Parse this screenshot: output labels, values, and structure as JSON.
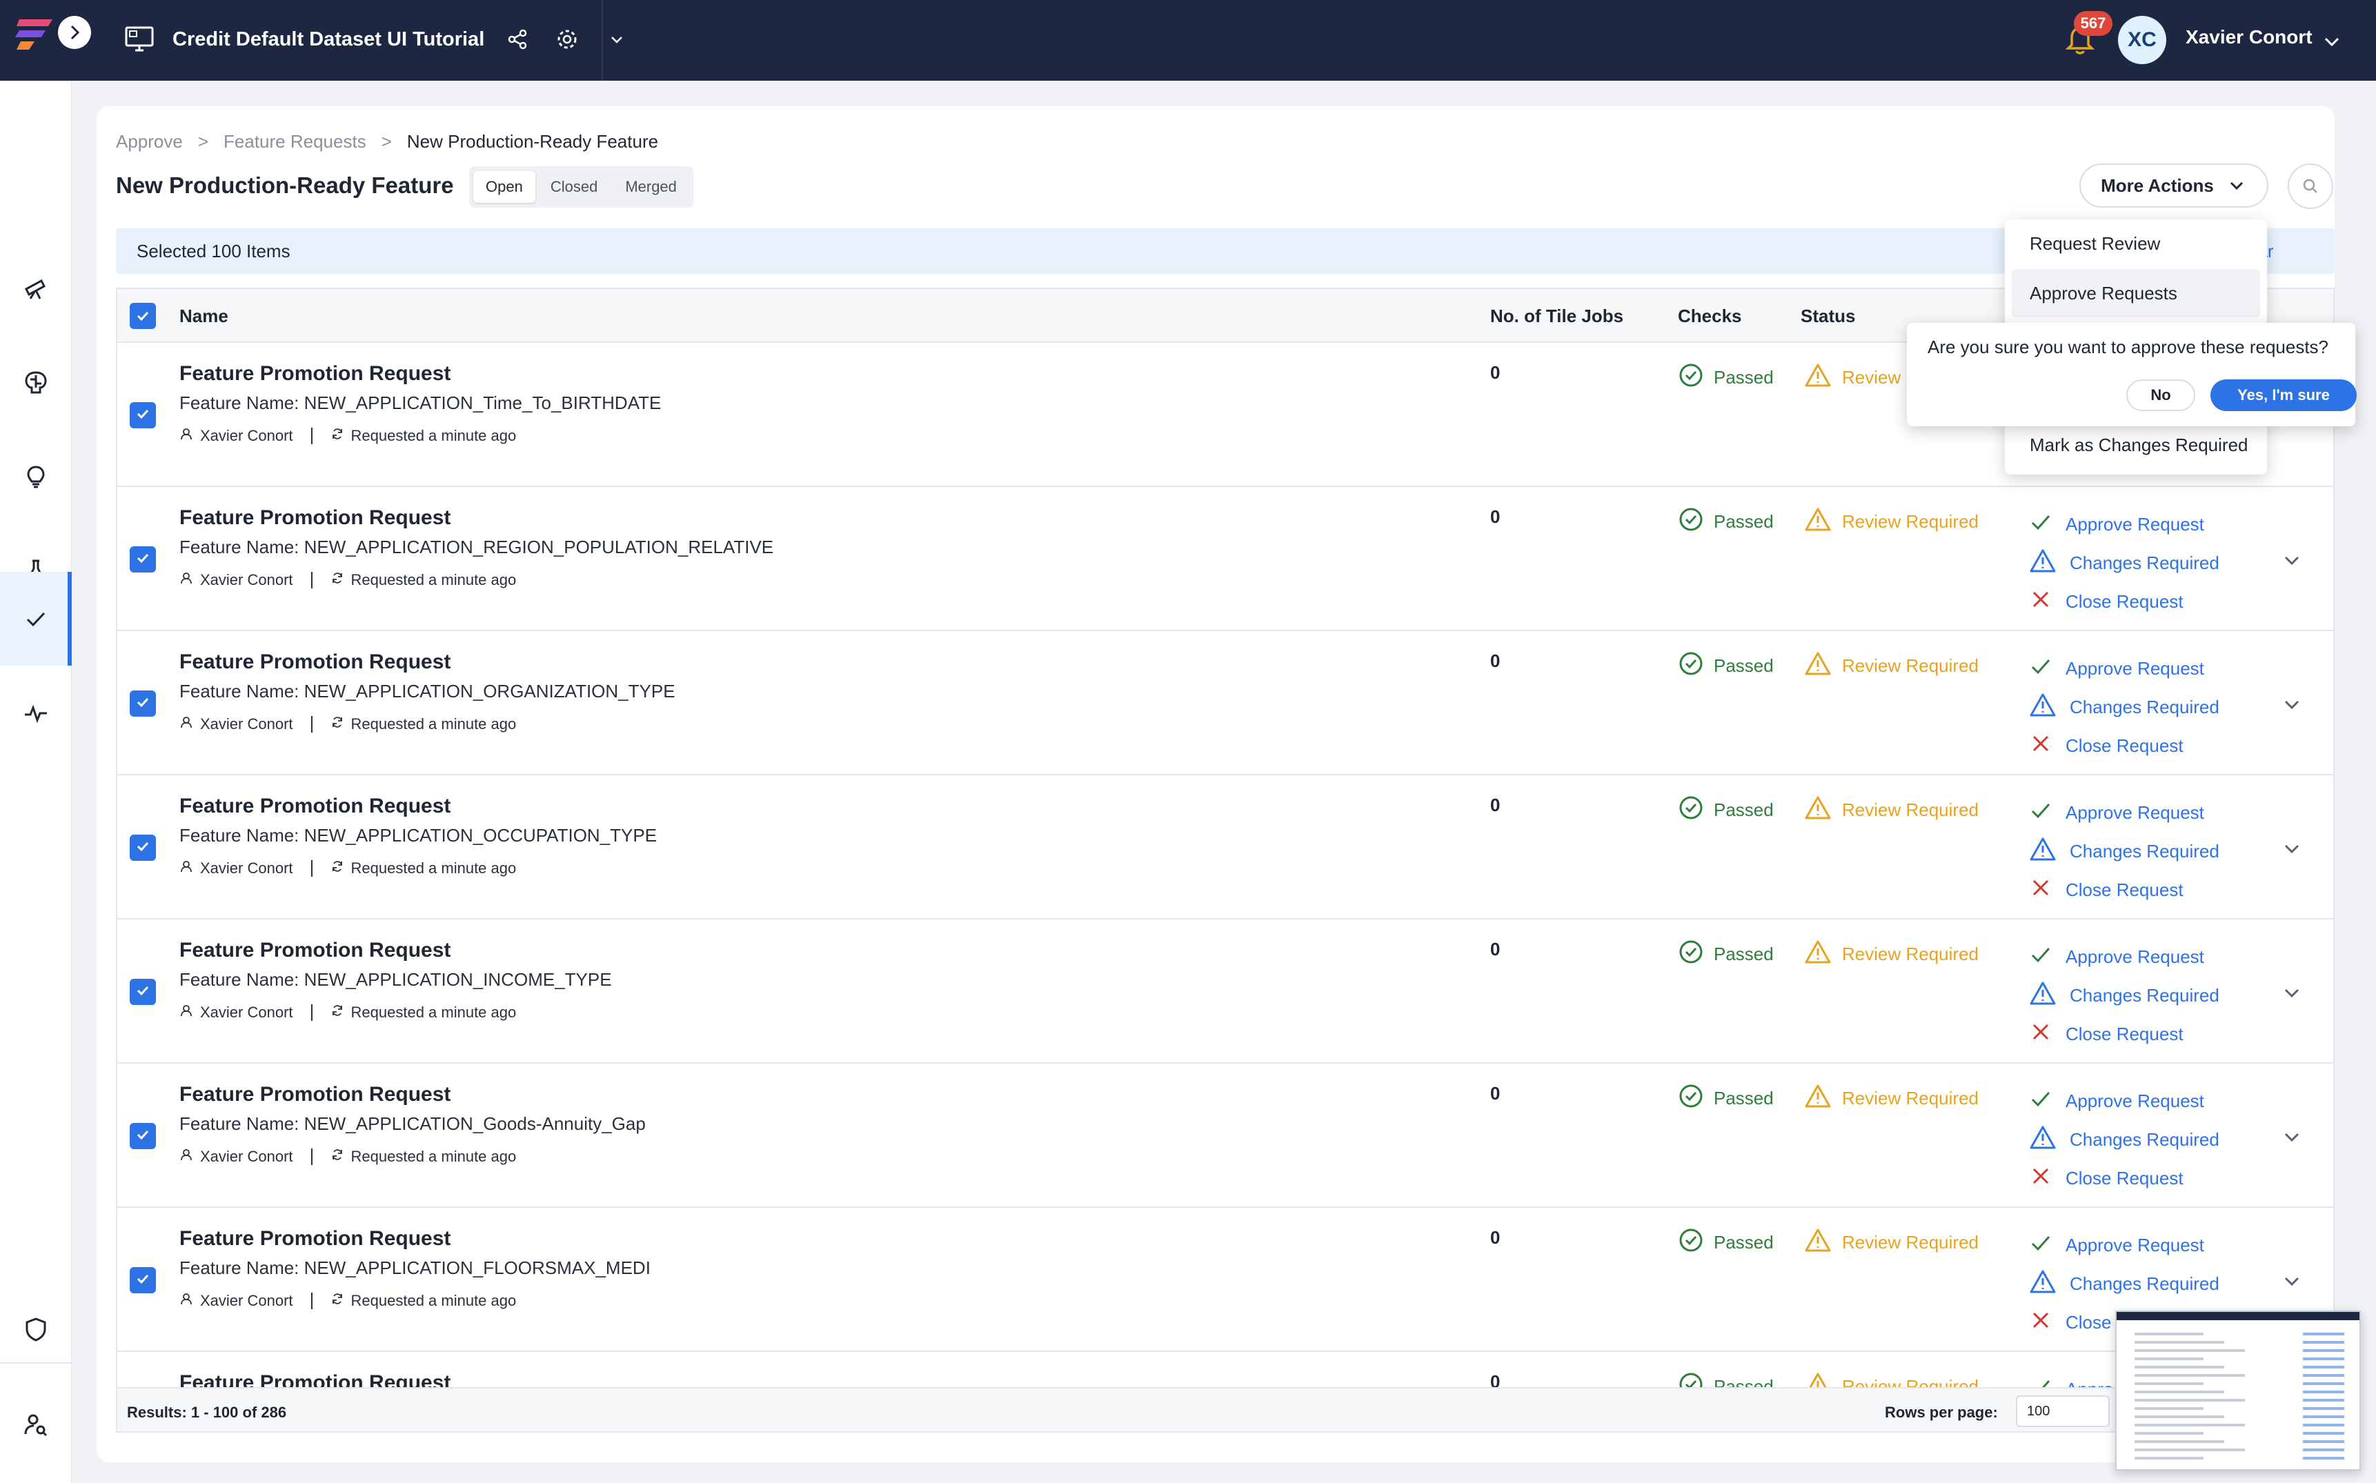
{
  "header": {
    "project_title": "Credit Default Dataset UI Tutorial",
    "notification_count": "567",
    "avatar_initials": "XC",
    "user_name": "Xavier Conort"
  },
  "breadcrumb": [
    "Approve",
    "Feature Requests",
    "New Production-Ready Feature"
  ],
  "breadcrumb_sep": ">",
  "page": {
    "title": "New Production-Ready Feature",
    "tabs": [
      "Open",
      "Closed",
      "Merged"
    ],
    "active_tab": "Open",
    "more_actions": "More Actions",
    "selection_text": "Selected 100 Items",
    "clear_label": "ear"
  },
  "table": {
    "columns": [
      "Name",
      "No. of Tile Jobs",
      "Checks",
      "Status"
    ],
    "rows": [
      {
        "title": "Feature Promotion Request",
        "feature": "Feature Name: NEW_APPLICATION_Time_To_BIRTHDATE",
        "author": "Xavier Conort",
        "time": "Requested a minute ago",
        "jobs": "0",
        "checks": "Passed",
        "status": "Review"
      },
      {
        "title": "Feature Promotion Request",
        "feature": "Feature Name: NEW_APPLICATION_REGION_POPULATION_RELATIVE",
        "author": "Xavier Conort",
        "time": "Requested a minute ago",
        "jobs": "0",
        "checks": "Passed",
        "status": "Review Required"
      },
      {
        "title": "Feature Promotion Request",
        "feature": "Feature Name: NEW_APPLICATION_ORGANIZATION_TYPE",
        "author": "Xavier Conort",
        "time": "Requested a minute ago",
        "jobs": "0",
        "checks": "Passed",
        "status": "Review Required"
      },
      {
        "title": "Feature Promotion Request",
        "feature": "Feature Name: NEW_APPLICATION_OCCUPATION_TYPE",
        "author": "Xavier Conort",
        "time": "Requested a minute ago",
        "jobs": "0",
        "checks": "Passed",
        "status": "Review Required"
      },
      {
        "title": "Feature Promotion Request",
        "feature": "Feature Name: NEW_APPLICATION_INCOME_TYPE",
        "author": "Xavier Conort",
        "time": "Requested a minute ago",
        "jobs": "0",
        "checks": "Passed",
        "status": "Review Required"
      },
      {
        "title": "Feature Promotion Request",
        "feature": "Feature Name: NEW_APPLICATION_Goods-Annuity_Gap",
        "author": "Xavier Conort",
        "time": "Requested a minute ago",
        "jobs": "0",
        "checks": "Passed",
        "status": "Review Required"
      },
      {
        "title": "Feature Promotion Request",
        "feature": "Feature Name: NEW_APPLICATION_FLOORSMAX_MEDI",
        "author": "Xavier Conort",
        "time": "Requested a minute ago",
        "jobs": "0",
        "checks": "Passed",
        "status": "Review Required"
      },
      {
        "title": "Feature Promotion Request",
        "feature": "",
        "author": "",
        "time": "",
        "jobs": "0",
        "checks": "Passed",
        "status": "Review Required"
      }
    ],
    "actions": {
      "approve": "Approve Request",
      "changes": "Changes Required",
      "close": "Close Request",
      "close_partial": "Close",
      "approve_partial": "Appro"
    },
    "footer": {
      "results": "Results: 1 - 100 of 286",
      "rows_per_page_label": "Rows per page:",
      "rows_per_page_value": "100"
    }
  },
  "menu": {
    "items": [
      "Request Review",
      "Approve Requests",
      "Mark as Changes Required"
    ],
    "highlighted": "Approve Requests"
  },
  "confirm": {
    "question": "Are you sure you want to approve these requests?",
    "no": "No",
    "yes": "Yes, I'm sure"
  },
  "colors": {
    "topbar": "#1d2742",
    "accent": "#2d73e6",
    "passed": "#2f7d3a",
    "warning": "#e6a323",
    "danger": "#d9342b"
  },
  "icons": {
    "rail": [
      "telescope-icon",
      "brain-icon",
      "lightbulb-icon",
      "flask-icon",
      "check-icon",
      "activity-icon",
      "shield-icon",
      "user-search-icon"
    ]
  }
}
